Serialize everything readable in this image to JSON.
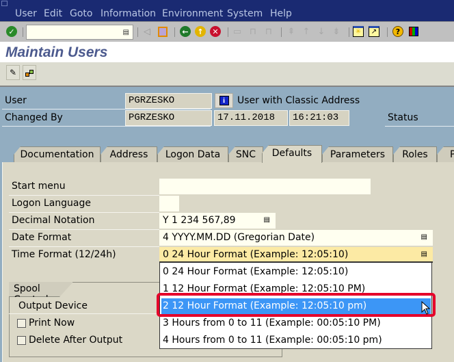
{
  "menu": {
    "items": [
      "User",
      "Edit",
      "Goto",
      "Information",
      "Environment",
      "System",
      "Help"
    ]
  },
  "toolbar": {
    "command_field_value": "",
    "icons": [
      "enter-icon",
      "command-dropdown-icon",
      "back-arrow-icon",
      "save-icon",
      "back-icon",
      "exit-icon",
      "cancel-icon",
      "print-icon",
      "find-icon",
      "find-next-icon",
      "first-page-icon",
      "previous-page-icon",
      "next-page-icon",
      "last-page-icon",
      "create-session-icon",
      "shortcut-icon",
      "help-icon",
      "customize-layout-icon"
    ]
  },
  "title": "Maintain Users",
  "app_toolbar": {
    "icons": [
      "change-icon",
      "org-structure-icon"
    ]
  },
  "header": {
    "user_label": "User",
    "user_value": "PGRZESKO",
    "user_type_text": "User with Classic Address",
    "changed_by_label": "Changed By",
    "changed_by_value": "PGRZESKO",
    "changed_date": "17.11.2018",
    "changed_time": "16:21:03",
    "status_label": "Status"
  },
  "tabs": [
    {
      "label": "Documentation"
    },
    {
      "label": "Address"
    },
    {
      "label": "Logon Data"
    },
    {
      "label": "SNC"
    },
    {
      "label": "Defaults",
      "active": true
    },
    {
      "label": "Parameters"
    },
    {
      "label": "Roles"
    },
    {
      "label": "P"
    }
  ],
  "defaults": {
    "start_menu_label": "Start menu",
    "start_menu_value": "",
    "logon_language_label": "Logon Language",
    "logon_language_value": "",
    "decimal_notation_label": "Decimal Notation",
    "decimal_notation_value": "Y 1 234 567,89",
    "date_format_label": "Date Format",
    "date_format_value": "4 YYYY.MM.DD (Gregorian Date)",
    "time_format_label": "Time Format (12/24h)",
    "time_format_value": "0 24 Hour Format (Example: 12:05:10)"
  },
  "time_format_options": [
    "0 24 Hour Format (Example: 12:05:10)",
    "1 12 Hour Format (Example: 12:05:10 PM)",
    "2 12 Hour Format (Example: 12:05:10 pm)",
    "3 Hours from 0 to 11 (Example: 00:05:10 PM)",
    "4 Hours from 0 to 11 (Example: 00:05:10 pm)"
  ],
  "highlighted_option_index": 2,
  "spool": {
    "title": "Spool Control",
    "output_device_label": "Output Device",
    "print_now_label": "Print Now",
    "print_now_checked": false,
    "delete_after_output_label": "Delete After Output",
    "delete_after_output_checked": false
  },
  "colors": {
    "menubar": "#1a2a72",
    "selection": "#3c96f6",
    "highlight_border": "#e5002a",
    "focus_field": "#fceaa4"
  }
}
